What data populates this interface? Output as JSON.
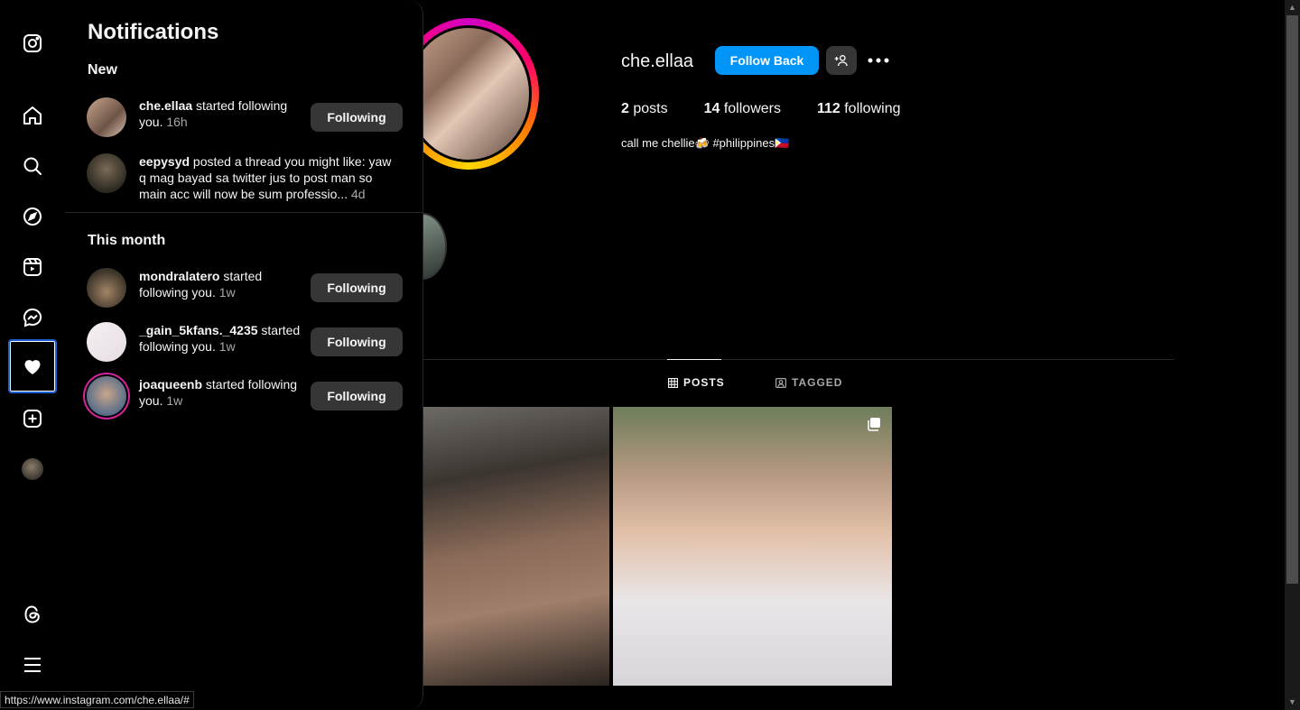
{
  "panel": {
    "title": "Notifications",
    "new_section": "New",
    "month_section": "This month",
    "new_items": [
      {
        "user": "che.ellaa",
        "text": " started following you.",
        "time": "16h",
        "button": "Following"
      },
      {
        "user": "eepysyd",
        "text": " posted a thread you might like: yaw q mag bayad sa twitter jus to post man so main acc will now be sum professio...",
        "time": "4d"
      }
    ],
    "month_items": [
      {
        "user": "mondralatero",
        "text": " started following you.",
        "time": "1w",
        "button": "Following"
      },
      {
        "user": "_gain_5kfans._4235",
        "text": " started following you.",
        "time": "1w",
        "button": "Following"
      },
      {
        "user": "joaqueenb",
        "text": " started following you.",
        "time": "1w",
        "button": "Following"
      }
    ]
  },
  "profile": {
    "username": "che.ellaa",
    "follow_back": "Follow Back",
    "stats": {
      "posts_count": "2",
      "posts_label": " posts",
      "followers_count": "14",
      "followers_label": " followers",
      "following_count": "112",
      "following_label": " following"
    },
    "bio": "call me chellie🍻 #philippines🇵🇭",
    "tabs": {
      "posts": "POSTS",
      "tagged": "TAGGED"
    }
  },
  "rail_icons": [
    "instagram-logo-icon",
    "home-icon",
    "search-icon",
    "explore-icon",
    "reels-icon",
    "messenger-icon",
    "heart-icon",
    "create-icon",
    "profile-avatar",
    "threads-icon",
    "menu-icon"
  ],
  "status_url": "https://www.instagram.com/che.ellaa/#",
  "colors": {
    "accent": "#0095f6",
    "background": "#000000",
    "button_gray": "#363636"
  }
}
